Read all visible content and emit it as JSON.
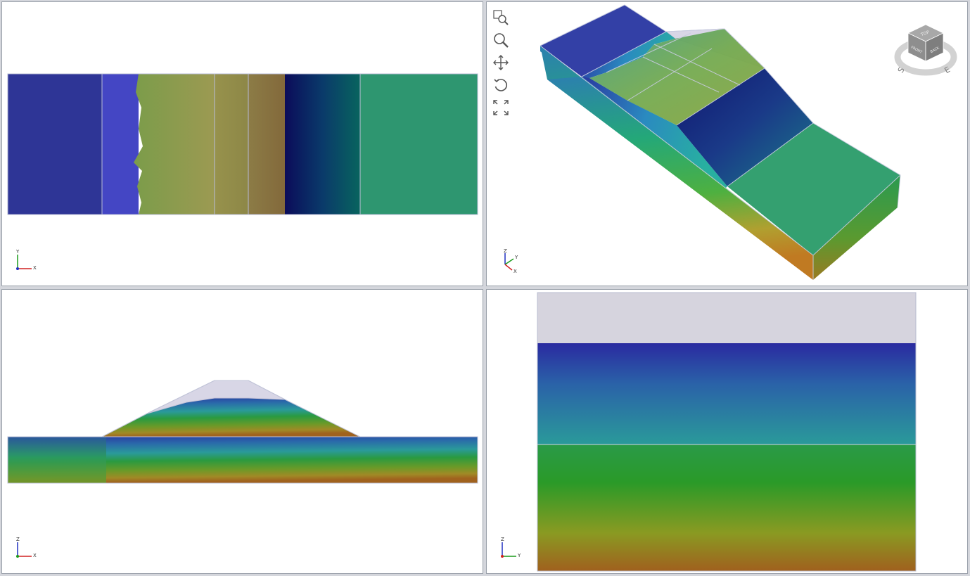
{
  "viewports": {
    "top": {
      "axis_labels": {
        "up": "Y",
        "right": "X"
      },
      "bands": [
        {
          "from": "#2e3596",
          "to": "#2e3596"
        },
        {
          "from": "#4446c4",
          "to": "#4446c4"
        },
        {
          "from": "#7d9b4a",
          "to": "#9a9a50"
        },
        {
          "from": "#94904a",
          "to": "#8e8a48"
        },
        {
          "from": "#8a7a45",
          "to": "#846c3c"
        },
        {
          "from": "#0b0c5c",
          "to": "#09635e"
        },
        {
          "from": "#2e9670",
          "to": "#2e9670"
        }
      ]
    },
    "iso": {
      "axis_labels": {
        "up": "Z",
        "right": "Y",
        "front": "X"
      },
      "toolbar": [
        {
          "name": "zoom-window",
          "icon": "zoom-window-icon"
        },
        {
          "name": "zoom",
          "icon": "magnifier-icon"
        },
        {
          "name": "pan",
          "icon": "pan-arrows-icon"
        },
        {
          "name": "rotate",
          "icon": "rotate-icon"
        },
        {
          "name": "zoom-extents",
          "icon": "zoom-extents-icon"
        }
      ],
      "nav_cube": {
        "face_top": "TOP",
        "face_front": "FRONT",
        "face_right": "BACK",
        "compass_s": "S",
        "compass_e": "E"
      }
    },
    "front": {
      "axis_labels": {
        "up": "Z",
        "right": "X"
      }
    },
    "side": {
      "axis_labels": {
        "up": "Z",
        "right": "Y"
      }
    }
  },
  "colors": {
    "background": "#ffffff",
    "frame": "#9aa0aa",
    "void": "#d6d4de",
    "edge": "#c8c8d8"
  }
}
